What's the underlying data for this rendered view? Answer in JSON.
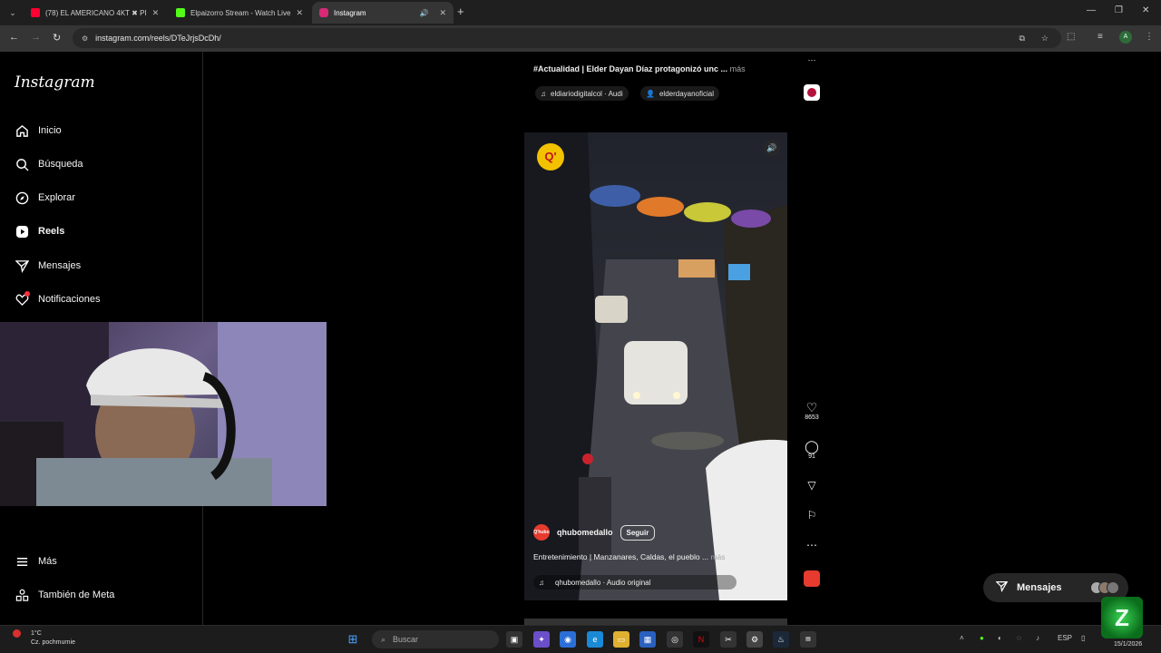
{
  "browser": {
    "tabs": [
      {
        "title": "(78) EL AMERICANO 4KT ✖ PI",
        "color": "#ff0033"
      },
      {
        "title": "Elpaizorro Stream - Watch Live",
        "color": "#53fc18"
      },
      {
        "title": "Instagram",
        "color": "#d62976"
      }
    ],
    "url": "instagram.com/reels/DTeJrjsDcDh/",
    "profile_initial": "A"
  },
  "sidebar": {
    "logo": "Instagram",
    "items": [
      {
        "label": "Inicio",
        "icon": "home-icon"
      },
      {
        "label": "Búsqueda",
        "icon": "search-icon"
      },
      {
        "label": "Explorar",
        "icon": "compass-icon"
      },
      {
        "label": "Reels",
        "icon": "reels-icon"
      },
      {
        "label": "Mensajes",
        "icon": "send-icon"
      },
      {
        "label": "Notificaciones",
        "icon": "heart-icon"
      }
    ],
    "bottom_items": [
      {
        "label": "Más",
        "icon": "menu-icon"
      },
      {
        "label": "También de Meta",
        "icon": "meta-icon"
      }
    ]
  },
  "prev_post": {
    "caption": "#Actualidad | Elder Dayan Díaz protagonizó unc ...",
    "more": "más",
    "audio": "eldiariodigitalcol · Audi",
    "tagged": "elderdayanoficial"
  },
  "reel": {
    "badge": "Q'",
    "username": "qhubomedallo",
    "follow": "Seguir",
    "caption": "Entretenimiento | Manzanares, Caldas, el pueblo ...",
    "more": "más",
    "audio": "qhubomedallo · Audio original",
    "likes": "8653",
    "comments": "91",
    "avatar_text": "Q'hubo"
  },
  "messages_button": "Mensajes",
  "taskbar": {
    "weather_temp": "1°C",
    "weather_text": "Cz. pochmurnie",
    "search": "Buscar",
    "lang": "ESP",
    "date": "15/1/2026"
  },
  "colors": {
    "accent": "#0095f6",
    "notification": "#ff3040"
  }
}
